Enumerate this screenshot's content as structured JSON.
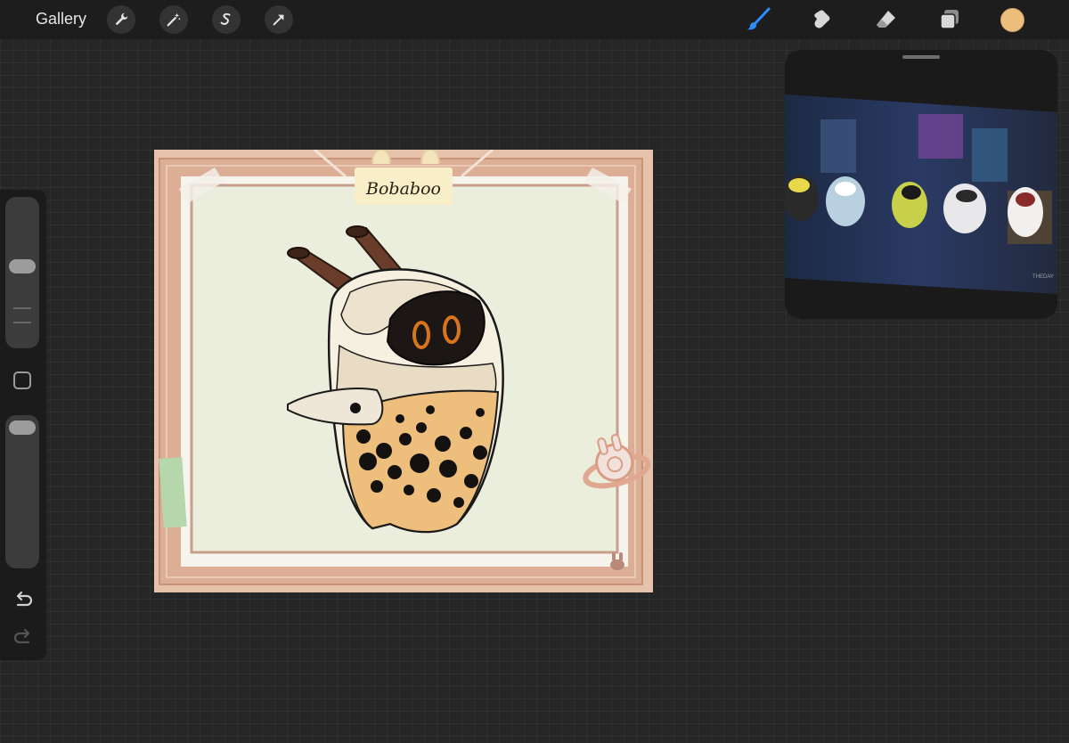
{
  "topbar": {
    "gallery_label": "Gallery",
    "left_tools": [
      "wrench-icon",
      "magic-wand-icon",
      "selection-icon",
      "transform-arrow-icon"
    ],
    "right_tools": [
      "brush-icon",
      "smudge-icon",
      "eraser-icon",
      "layers-icon"
    ],
    "active_tool": "brush-icon",
    "accent_color": "#2b8cff",
    "current_color": "#eebf7c"
  },
  "sidebar": {
    "brush_size_level": 0.55,
    "opacity_level": 1.0
  },
  "canvas": {
    "name_tag": "Bobaboo"
  },
  "reference": {
    "watermark": "THEDAY"
  }
}
